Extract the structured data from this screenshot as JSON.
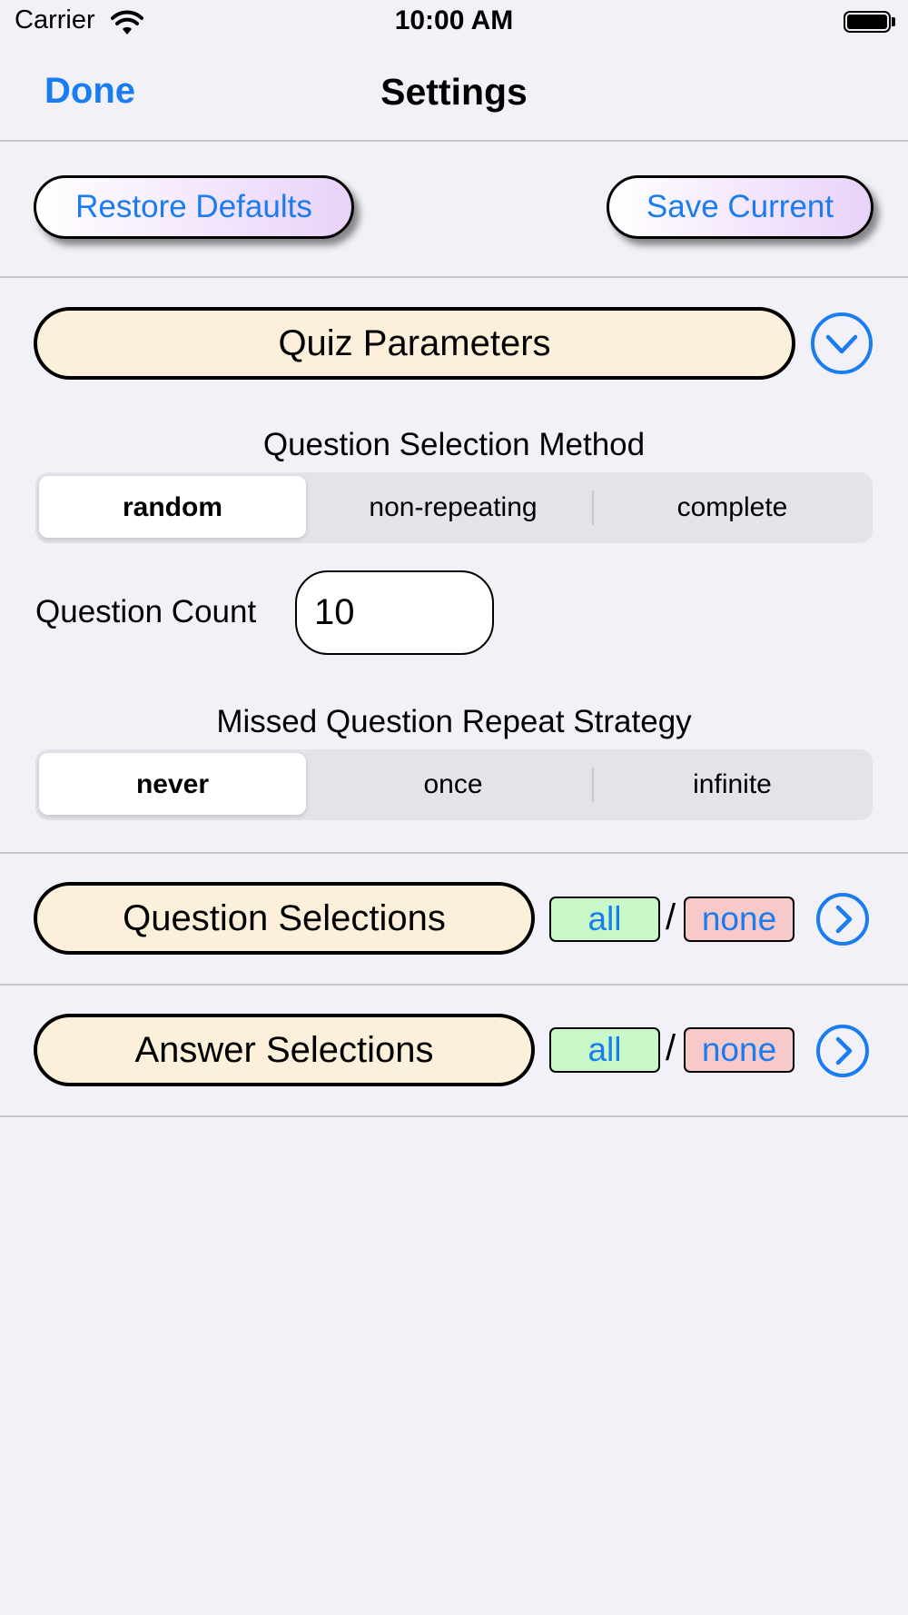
{
  "status_bar": {
    "carrier": "Carrier",
    "time": "10:00 AM"
  },
  "nav": {
    "done_label": "Done",
    "title": "Settings"
  },
  "toolbar": {
    "restore_label": "Restore Defaults",
    "save_label": "Save Current"
  },
  "quiz_parameters": {
    "header": "Quiz Parameters",
    "selection_method": {
      "label": "Question Selection Method",
      "options": [
        "random",
        "non-repeating",
        "complete"
      ],
      "selected": "random"
    },
    "question_count": {
      "label": "Question Count",
      "value": "10"
    },
    "repeat_strategy": {
      "label": "Missed Question Repeat Strategy",
      "options": [
        "never",
        "once",
        "infinite"
      ],
      "selected": "never"
    }
  },
  "question_selections": {
    "header": "Question Selections",
    "all_label": "all",
    "slash": "/",
    "none_label": "none"
  },
  "answer_selections": {
    "header": "Answer Selections",
    "all_label": "all",
    "slash": "/",
    "none_label": "none"
  },
  "colors": {
    "accent": "#1a7cf1",
    "section_fill": "#fdf0da",
    "all_fill": "#c8f7c8",
    "none_fill": "#f7c9c9",
    "background": "#f2f1f7"
  },
  "icons": [
    "wifi-icon",
    "battery-icon",
    "chevron-down-circle-icon",
    "chevron-right-circle-icon"
  ]
}
